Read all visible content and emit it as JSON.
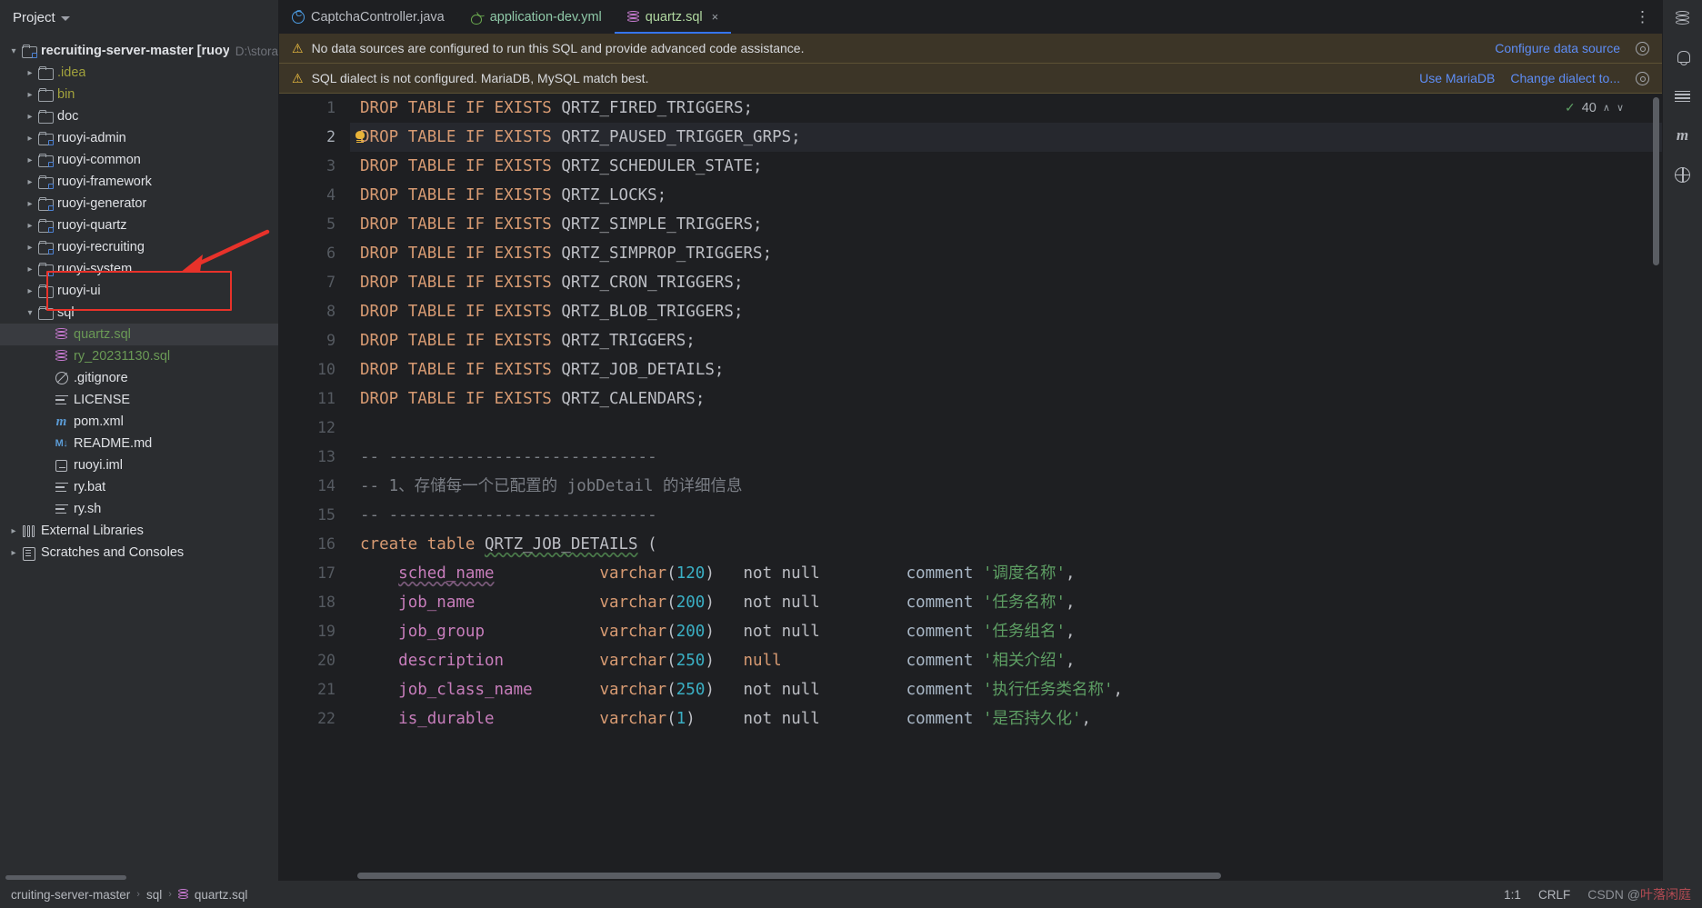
{
  "project_panel": {
    "title": "Project",
    "tree": [
      {
        "indent": 0,
        "arrow": "down",
        "icon": "module-folder-icon",
        "label": "recruiting-server-master [ruoyi]",
        "sub": "D:\\stora",
        "bold": true
      },
      {
        "indent": 1,
        "arrow": "right",
        "icon": "folder-icon",
        "label": ".idea",
        "color": "yellow"
      },
      {
        "indent": 1,
        "arrow": "right",
        "icon": "folder-icon",
        "label": "bin",
        "color": "yellow"
      },
      {
        "indent": 1,
        "arrow": "right",
        "icon": "folder-icon",
        "label": "doc"
      },
      {
        "indent": 1,
        "arrow": "right",
        "icon": "module-folder-icon",
        "label": "ruoyi-admin"
      },
      {
        "indent": 1,
        "arrow": "right",
        "icon": "module-folder-icon",
        "label": "ruoyi-common"
      },
      {
        "indent": 1,
        "arrow": "right",
        "icon": "module-folder-icon",
        "label": "ruoyi-framework"
      },
      {
        "indent": 1,
        "arrow": "right",
        "icon": "module-folder-icon",
        "label": "ruoyi-generator"
      },
      {
        "indent": 1,
        "arrow": "right",
        "icon": "module-folder-icon",
        "label": "ruoyi-quartz"
      },
      {
        "indent": 1,
        "arrow": "right",
        "icon": "module-folder-icon",
        "label": "ruoyi-recruiting"
      },
      {
        "indent": 1,
        "arrow": "right",
        "icon": "module-folder-icon",
        "label": "ruoyi-system"
      },
      {
        "indent": 1,
        "arrow": "right",
        "icon": "folder-icon",
        "label": "ruoyi-ui"
      },
      {
        "indent": 1,
        "arrow": "down",
        "icon": "folder-icon",
        "label": "sql"
      },
      {
        "indent": 2,
        "arrow": "none",
        "icon": "sql-file-icon",
        "label": "quartz.sql",
        "color": "green",
        "selected": true
      },
      {
        "indent": 2,
        "arrow": "none",
        "icon": "sql-file-icon",
        "label": "ry_20231130.sql",
        "color": "green"
      },
      {
        "indent": 2,
        "arrow": "none",
        "icon": "gitignore-icon",
        "label": ".gitignore"
      },
      {
        "indent": 2,
        "arrow": "none",
        "icon": "license-icon",
        "label": "LICENSE"
      },
      {
        "indent": 2,
        "arrow": "none",
        "icon": "maven-icon",
        "label": "pom.xml"
      },
      {
        "indent": 2,
        "arrow": "none",
        "icon": "markdown-icon",
        "label": "README.md"
      },
      {
        "indent": 2,
        "arrow": "none",
        "icon": "iml-icon",
        "label": "ruoyi.iml"
      },
      {
        "indent": 2,
        "arrow": "none",
        "icon": "license-icon",
        "label": "ry.bat"
      },
      {
        "indent": 2,
        "arrow": "none",
        "icon": "license-icon",
        "label": "ry.sh"
      },
      {
        "indent": 0,
        "arrow": "right",
        "icon": "external-libraries-icon",
        "label": "External Libraries"
      },
      {
        "indent": 0,
        "arrow": "right",
        "icon": "scratches-icon",
        "label": "Scratches and Consoles"
      }
    ]
  },
  "tabs": [
    {
      "label": "CaptchaController.java",
      "icon": "java-class-icon",
      "active": false,
      "closable": false
    },
    {
      "label": "application-dev.yml",
      "icon": "yaml-file-icon",
      "active": false,
      "closable": false
    },
    {
      "label": "quartz.sql",
      "icon": "sql-file-icon",
      "active": true,
      "closable": true,
      "close_label": "×"
    }
  ],
  "tabbar": {
    "more_label": "⋮"
  },
  "banners": [
    {
      "message": "No data sources are configured to run this SQL and provide advanced code assistance.",
      "actions": [
        "Configure data source"
      ],
      "settings_icon": "gear-icon"
    },
    {
      "message": "SQL dialect is not configured. MariaDB, MySQL match best.",
      "actions": [
        "Use MariaDB",
        "Change dialect to..."
      ],
      "settings_icon": "gear-icon"
    }
  ],
  "inspection_widget": {
    "count": "40",
    "check_icon": "check-icon",
    "up_caret": "∧",
    "down_caret": "∨"
  },
  "editor": {
    "current_line": 2,
    "lines": [
      {
        "n": 1,
        "tokens": [
          {
            "t": "DROP",
            "c": "kw"
          },
          {
            "t": " ",
            "c": "ident"
          },
          {
            "t": "TABLE",
            "c": "kw"
          },
          {
            "t": " ",
            "c": "ident"
          },
          {
            "t": "IF",
            "c": "kw"
          },
          {
            "t": " ",
            "c": "ident"
          },
          {
            "t": "EXISTS",
            "c": "kw"
          },
          {
            "t": " QRTZ_FIRED_TRIGGERS;",
            "c": "ident"
          }
        ]
      },
      {
        "n": 2,
        "tokens": [
          {
            "t": "DROP",
            "c": "kw"
          },
          {
            "t": " ",
            "c": "ident"
          },
          {
            "t": "TABLE",
            "c": "kw"
          },
          {
            "t": " ",
            "c": "ident"
          },
          {
            "t": "IF",
            "c": "kw"
          },
          {
            "t": " ",
            "c": "ident"
          },
          {
            "t": "EXISTS",
            "c": "kw"
          },
          {
            "t": " QRTZ_PAUSED_TRIGGER_GRPS;",
            "c": "ident"
          }
        ]
      },
      {
        "n": 3,
        "tokens": [
          {
            "t": "DROP",
            "c": "kw"
          },
          {
            "t": " ",
            "c": "ident"
          },
          {
            "t": "TABLE",
            "c": "kw"
          },
          {
            "t": " ",
            "c": "ident"
          },
          {
            "t": "IF",
            "c": "kw"
          },
          {
            "t": " ",
            "c": "ident"
          },
          {
            "t": "EXISTS",
            "c": "kw"
          },
          {
            "t": " QRTZ_SCHEDULER_STATE;",
            "c": "ident"
          }
        ]
      },
      {
        "n": 4,
        "tokens": [
          {
            "t": "DROP",
            "c": "kw"
          },
          {
            "t": " ",
            "c": "ident"
          },
          {
            "t": "TABLE",
            "c": "kw"
          },
          {
            "t": " ",
            "c": "ident"
          },
          {
            "t": "IF",
            "c": "kw"
          },
          {
            "t": " ",
            "c": "ident"
          },
          {
            "t": "EXISTS",
            "c": "kw"
          },
          {
            "t": " QRTZ_LOCKS;",
            "c": "ident"
          }
        ]
      },
      {
        "n": 5,
        "tokens": [
          {
            "t": "DROP",
            "c": "kw"
          },
          {
            "t": " ",
            "c": "ident"
          },
          {
            "t": "TABLE",
            "c": "kw"
          },
          {
            "t": " ",
            "c": "ident"
          },
          {
            "t": "IF",
            "c": "kw"
          },
          {
            "t": " ",
            "c": "ident"
          },
          {
            "t": "EXISTS",
            "c": "kw"
          },
          {
            "t": " QRTZ_SIMPLE_TRIGGERS;",
            "c": "ident"
          }
        ]
      },
      {
        "n": 6,
        "tokens": [
          {
            "t": "DROP",
            "c": "kw"
          },
          {
            "t": " ",
            "c": "ident"
          },
          {
            "t": "TABLE",
            "c": "kw"
          },
          {
            "t": " ",
            "c": "ident"
          },
          {
            "t": "IF",
            "c": "kw"
          },
          {
            "t": " ",
            "c": "ident"
          },
          {
            "t": "EXISTS",
            "c": "kw"
          },
          {
            "t": " QRTZ_SIMPROP_TRIGGERS;",
            "c": "ident"
          }
        ]
      },
      {
        "n": 7,
        "tokens": [
          {
            "t": "DROP",
            "c": "kw"
          },
          {
            "t": " ",
            "c": "ident"
          },
          {
            "t": "TABLE",
            "c": "kw"
          },
          {
            "t": " ",
            "c": "ident"
          },
          {
            "t": "IF",
            "c": "kw"
          },
          {
            "t": " ",
            "c": "ident"
          },
          {
            "t": "EXISTS",
            "c": "kw"
          },
          {
            "t": " QRTZ_CRON_TRIGGERS;",
            "c": "ident"
          }
        ]
      },
      {
        "n": 8,
        "tokens": [
          {
            "t": "DROP",
            "c": "kw"
          },
          {
            "t": " ",
            "c": "ident"
          },
          {
            "t": "TABLE",
            "c": "kw"
          },
          {
            "t": " ",
            "c": "ident"
          },
          {
            "t": "IF",
            "c": "kw"
          },
          {
            "t": " ",
            "c": "ident"
          },
          {
            "t": "EXISTS",
            "c": "kw"
          },
          {
            "t": " QRTZ_BLOB_TRIGGERS;",
            "c": "ident"
          }
        ]
      },
      {
        "n": 9,
        "tokens": [
          {
            "t": "DROP",
            "c": "kw"
          },
          {
            "t": " ",
            "c": "ident"
          },
          {
            "t": "TABLE",
            "c": "kw"
          },
          {
            "t": " ",
            "c": "ident"
          },
          {
            "t": "IF",
            "c": "kw"
          },
          {
            "t": " ",
            "c": "ident"
          },
          {
            "t": "EXISTS",
            "c": "kw"
          },
          {
            "t": " QRTZ_TRIGGERS;",
            "c": "ident"
          }
        ]
      },
      {
        "n": 10,
        "tokens": [
          {
            "t": "DROP",
            "c": "kw"
          },
          {
            "t": " ",
            "c": "ident"
          },
          {
            "t": "TABLE",
            "c": "kw"
          },
          {
            "t": " ",
            "c": "ident"
          },
          {
            "t": "IF",
            "c": "kw"
          },
          {
            "t": " ",
            "c": "ident"
          },
          {
            "t": "EXISTS",
            "c": "kw"
          },
          {
            "t": " QRTZ_JOB_DETAILS;",
            "c": "ident"
          }
        ]
      },
      {
        "n": 11,
        "tokens": [
          {
            "t": "DROP",
            "c": "kw"
          },
          {
            "t": " ",
            "c": "ident"
          },
          {
            "t": "TABLE",
            "c": "kw"
          },
          {
            "t": " ",
            "c": "ident"
          },
          {
            "t": "IF",
            "c": "kw"
          },
          {
            "t": " ",
            "c": "ident"
          },
          {
            "t": "EXISTS",
            "c": "kw"
          },
          {
            "t": " QRTZ_CALENDARS;",
            "c": "ident"
          }
        ]
      },
      {
        "n": 12,
        "tokens": []
      },
      {
        "n": 13,
        "tokens": [
          {
            "t": "-- ----------------------------",
            "c": "cmt"
          }
        ]
      },
      {
        "n": 14,
        "tokens": [
          {
            "t": "-- 1、存储每一个已配置的 jobDetail 的详细信息",
            "c": "cmt"
          }
        ]
      },
      {
        "n": 15,
        "tokens": [
          {
            "t": "-- ----------------------------",
            "c": "cmt"
          }
        ]
      },
      {
        "n": 16,
        "tokens": [
          {
            "t": "create",
            "c": "kw"
          },
          {
            "t": " ",
            "c": "ident"
          },
          {
            "t": "table",
            "c": "kw"
          },
          {
            "t": " ",
            "c": "ident"
          },
          {
            "t": "QRTZ_JOB_DETAILS",
            "c": "ident squiggle"
          },
          {
            "t": " (",
            "c": "ident"
          }
        ]
      },
      {
        "n": 17,
        "tokens": [
          {
            "t": "    ",
            "c": "ident"
          },
          {
            "t": "sched_name",
            "c": "col squiggle-p"
          },
          {
            "t": "           ",
            "c": "ident"
          },
          {
            "t": "varchar",
            "c": "kw"
          },
          {
            "t": "(",
            "c": "ident"
          },
          {
            "t": "120",
            "c": "num"
          },
          {
            "t": ")",
            "c": "ident"
          },
          {
            "t": "   ",
            "c": "ident"
          },
          {
            "t": "not null",
            "c": "ident"
          },
          {
            "t": "         ",
            "c": "ident"
          },
          {
            "t": "comment",
            "c": "fn"
          },
          {
            "t": " ",
            "c": "ident"
          },
          {
            "t": "'调度名称'",
            "c": "str"
          },
          {
            "t": ",",
            "c": "ident"
          }
        ]
      },
      {
        "n": 18,
        "tokens": [
          {
            "t": "    ",
            "c": "ident"
          },
          {
            "t": "job_name",
            "c": "col"
          },
          {
            "t": "             ",
            "c": "ident"
          },
          {
            "t": "varchar",
            "c": "kw"
          },
          {
            "t": "(",
            "c": "ident"
          },
          {
            "t": "200",
            "c": "num"
          },
          {
            "t": ")",
            "c": "ident"
          },
          {
            "t": "   ",
            "c": "ident"
          },
          {
            "t": "not null",
            "c": "ident"
          },
          {
            "t": "         ",
            "c": "ident"
          },
          {
            "t": "comment",
            "c": "fn"
          },
          {
            "t": " ",
            "c": "ident"
          },
          {
            "t": "'任务名称'",
            "c": "str"
          },
          {
            "t": ",",
            "c": "ident"
          }
        ]
      },
      {
        "n": 19,
        "tokens": [
          {
            "t": "    ",
            "c": "ident"
          },
          {
            "t": "job_group",
            "c": "col"
          },
          {
            "t": "            ",
            "c": "ident"
          },
          {
            "t": "varchar",
            "c": "kw"
          },
          {
            "t": "(",
            "c": "ident"
          },
          {
            "t": "200",
            "c": "num"
          },
          {
            "t": ")",
            "c": "ident"
          },
          {
            "t": "   ",
            "c": "ident"
          },
          {
            "t": "not null",
            "c": "ident"
          },
          {
            "t": "         ",
            "c": "ident"
          },
          {
            "t": "comment",
            "c": "fn"
          },
          {
            "t": " ",
            "c": "ident"
          },
          {
            "t": "'任务组名'",
            "c": "str"
          },
          {
            "t": ",",
            "c": "ident"
          }
        ]
      },
      {
        "n": 20,
        "tokens": [
          {
            "t": "    ",
            "c": "ident"
          },
          {
            "t": "description",
            "c": "col"
          },
          {
            "t": "          ",
            "c": "ident"
          },
          {
            "t": "varchar",
            "c": "kw"
          },
          {
            "t": "(",
            "c": "ident"
          },
          {
            "t": "250",
            "c": "num"
          },
          {
            "t": ")",
            "c": "ident"
          },
          {
            "t": "   ",
            "c": "ident"
          },
          {
            "t": "null",
            "c": "kw"
          },
          {
            "t": "             ",
            "c": "ident"
          },
          {
            "t": "comment",
            "c": "fn"
          },
          {
            "t": " ",
            "c": "ident"
          },
          {
            "t": "'相关介绍'",
            "c": "str"
          },
          {
            "t": ",",
            "c": "ident"
          }
        ]
      },
      {
        "n": 21,
        "tokens": [
          {
            "t": "    ",
            "c": "ident"
          },
          {
            "t": "job_class_name",
            "c": "col"
          },
          {
            "t": "       ",
            "c": "ident"
          },
          {
            "t": "varchar",
            "c": "kw"
          },
          {
            "t": "(",
            "c": "ident"
          },
          {
            "t": "250",
            "c": "num"
          },
          {
            "t": ")",
            "c": "ident"
          },
          {
            "t": "   ",
            "c": "ident"
          },
          {
            "t": "not null",
            "c": "ident"
          },
          {
            "t": "         ",
            "c": "ident"
          },
          {
            "t": "comment",
            "c": "fn"
          },
          {
            "t": " ",
            "c": "ident"
          },
          {
            "t": "'执行任务类名称'",
            "c": "str"
          },
          {
            "t": ",",
            "c": "ident"
          }
        ]
      },
      {
        "n": 22,
        "tokens": [
          {
            "t": "    ",
            "c": "ident"
          },
          {
            "t": "is_durable",
            "c": "col"
          },
          {
            "t": "           ",
            "c": "ident"
          },
          {
            "t": "varchar",
            "c": "kw"
          },
          {
            "t": "(",
            "c": "ident"
          },
          {
            "t": "1",
            "c": "num"
          },
          {
            "t": ")",
            "c": "ident"
          },
          {
            "t": "     ",
            "c": "ident"
          },
          {
            "t": "not null",
            "c": "ident"
          },
          {
            "t": "         ",
            "c": "ident"
          },
          {
            "t": "comment",
            "c": "fn"
          },
          {
            "t": " ",
            "c": "ident"
          },
          {
            "t": "'是否持久化'",
            "c": "str"
          },
          {
            "t": ",",
            "c": "ident"
          }
        ]
      }
    ]
  },
  "right_strip": [
    {
      "icon": "database-icon"
    },
    {
      "icon": "notifications-icon"
    },
    {
      "icon": "structure-icon"
    },
    {
      "icon": "maven-icon"
    },
    {
      "icon": "web-icon"
    }
  ],
  "statusbar": {
    "breadcrumb": [
      "cruiting-server-master",
      "sql",
      "quartz.sql"
    ],
    "breadcrumb_icon": "sql-file-icon",
    "separator": "›",
    "caret_position": "1:1",
    "line_separator": "CRLF",
    "watermark_prefix": "CSDN @",
    "watermark_cn": "叶落闲庭"
  }
}
